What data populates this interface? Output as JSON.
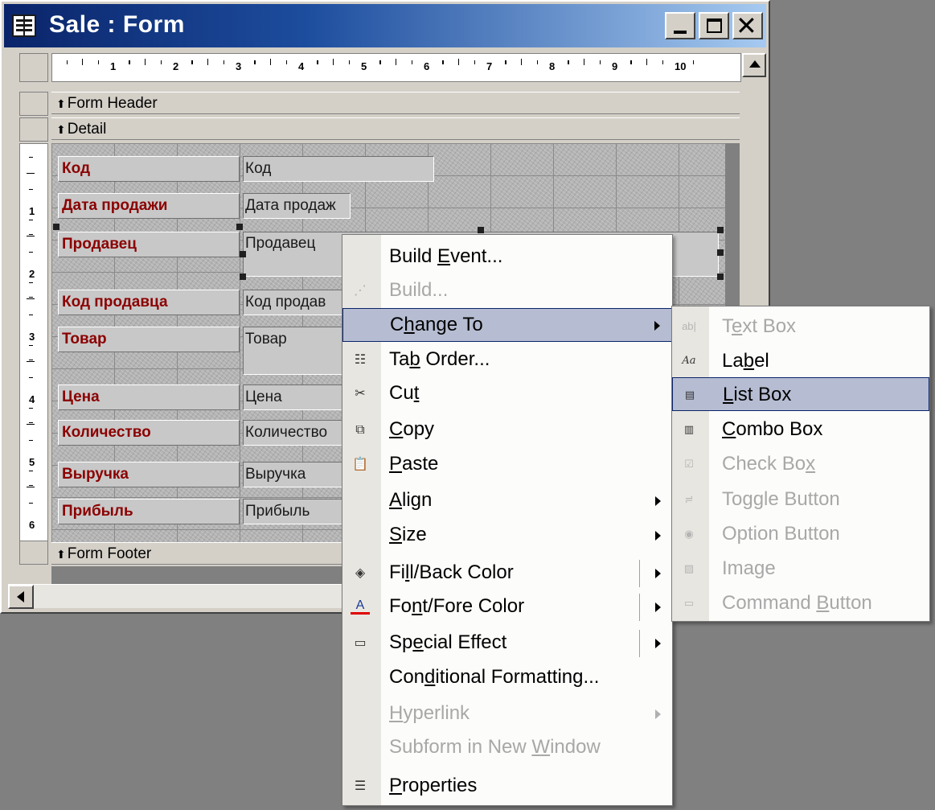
{
  "window": {
    "title": "Sale : Form"
  },
  "ruler": {
    "h_numbers": [
      "1",
      "2",
      "3",
      "4",
      "5",
      "6",
      "7",
      "8",
      "9",
      "10"
    ],
    "v_numbers": [
      "1",
      "2",
      "3",
      "4",
      "5",
      "6"
    ]
  },
  "sections": {
    "header": "Form Header",
    "detail": "Detail",
    "footer": "Form Footer"
  },
  "fields": [
    {
      "label": "Код",
      "control": "Код"
    },
    {
      "label": "Дата продажи",
      "control": "Дата продаж"
    },
    {
      "label": "Продавец",
      "control": "Продавец"
    },
    {
      "label": "Код продавца",
      "control": "Код продав"
    },
    {
      "label": "Товар",
      "control": "Товар"
    },
    {
      "label": "Цена",
      "control": "Цена"
    },
    {
      "label": "Количество",
      "control": "Количество"
    },
    {
      "label": "Выручка",
      "control": "Выручка"
    },
    {
      "label": "Прибыль",
      "control": "Прибыль"
    }
  ],
  "context_menu": {
    "items": [
      {
        "pre": "Build ",
        "key": "E",
        "post": "vent...",
        "icon": "",
        "disabled": false,
        "submenu": false
      },
      {
        "pre": "Build...",
        "key": "",
        "post": "",
        "icon": "build-icon",
        "disabled": true,
        "submenu": false
      },
      {
        "pre": "C",
        "key": "h",
        "post": "ange To",
        "icon": "",
        "disabled": false,
        "submenu": true,
        "highlighted": true
      },
      {
        "pre": "Ta",
        "key": "b",
        "post": " Order...",
        "icon": "tab-order-icon",
        "disabled": false,
        "submenu": false
      },
      {
        "pre": "Cu",
        "key": "t",
        "post": "",
        "icon": "scissors-icon",
        "disabled": false,
        "submenu": false
      },
      {
        "pre": "",
        "key": "C",
        "post": "opy",
        "icon": "copy-icon",
        "disabled": false,
        "submenu": false
      },
      {
        "pre": "",
        "key": "P",
        "post": "aste",
        "icon": "paste-icon",
        "disabled": false,
        "submenu": false
      },
      {
        "pre": "",
        "key": "A",
        "post": "lign",
        "icon": "",
        "disabled": false,
        "submenu": true
      },
      {
        "pre": "",
        "key": "S",
        "post": "ize",
        "icon": "",
        "disabled": false,
        "submenu": true
      },
      {
        "pre": "Fi",
        "key": "l",
        "post": "l/Back Color",
        "icon": "fill-color-icon",
        "disabled": false,
        "submenu": true
      },
      {
        "pre": "Fo",
        "key": "n",
        "post": "t/Fore Color",
        "icon": "font-color-icon",
        "disabled": false,
        "submenu": true
      },
      {
        "pre": "Sp",
        "key": "e",
        "post": "cial Effect",
        "icon": "special-effect-icon",
        "disabled": false,
        "submenu": true
      },
      {
        "pre": "Con",
        "key": "d",
        "post": "itional Formatting...",
        "icon": "",
        "disabled": false,
        "submenu": false
      },
      {
        "pre": "",
        "key": "H",
        "post": "yperlink",
        "icon": "",
        "disabled": true,
        "submenu": true
      },
      {
        "pre": "Subform in New ",
        "key": "W",
        "post": "indow",
        "icon": "",
        "disabled": true,
        "submenu": false
      },
      {
        "pre": "",
        "key": "P",
        "post": "roperties",
        "icon": "properties-icon",
        "disabled": false,
        "submenu": false
      }
    ]
  },
  "submenu": {
    "items": [
      {
        "pre": "T",
        "key": "e",
        "post": "xt Box",
        "icon_text": "ab|",
        "disabled": true
      },
      {
        "pre": "La",
        "key": "b",
        "post": "el",
        "icon_text": "Aa",
        "disabled": false
      },
      {
        "pre": "",
        "key": "L",
        "post": "ist Box",
        "icon_text": "▤",
        "disabled": false,
        "highlighted": true
      },
      {
        "pre": "",
        "key": "C",
        "post": "ombo Box",
        "icon_text": "▥",
        "disabled": false
      },
      {
        "pre": "Check Bo",
        "key": "x",
        "post": "",
        "icon_text": "☑",
        "disabled": true
      },
      {
        "pre": "Toggle Button",
        "key": "",
        "post": "",
        "icon_text": "≓",
        "disabled": true
      },
      {
        "pre": "Option Button",
        "key": "",
        "post": "",
        "icon_text": "◉",
        "disabled": true
      },
      {
        "pre": "Image",
        "key": "",
        "post": "",
        "icon_text": "▨",
        "disabled": true
      },
      {
        "pre": "Command ",
        "key": "B",
        "post": "utton",
        "icon_text": "▭",
        "disabled": true
      }
    ]
  }
}
